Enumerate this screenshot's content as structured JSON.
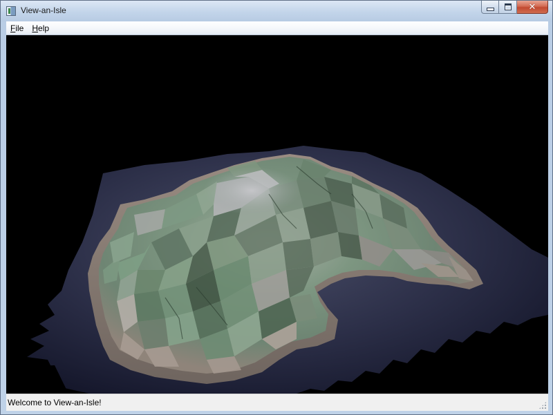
{
  "window": {
    "title": "View-an-Isle"
  },
  "caption_buttons": {
    "minimize_icon": "minimize-icon",
    "maximize_icon": "restore-icon",
    "close_icon": "close-icon",
    "close_color": "#c7432b"
  },
  "menu": {
    "items": [
      {
        "label_accel": "F",
        "label_rest": "ile"
      },
      {
        "label_accel": "H",
        "label_rest": "elp"
      }
    ]
  },
  "viewport": {
    "background": "#000000",
    "content": "3d-island-terrain"
  },
  "status": {
    "message": "Welcome to View-an-Isle!"
  }
}
